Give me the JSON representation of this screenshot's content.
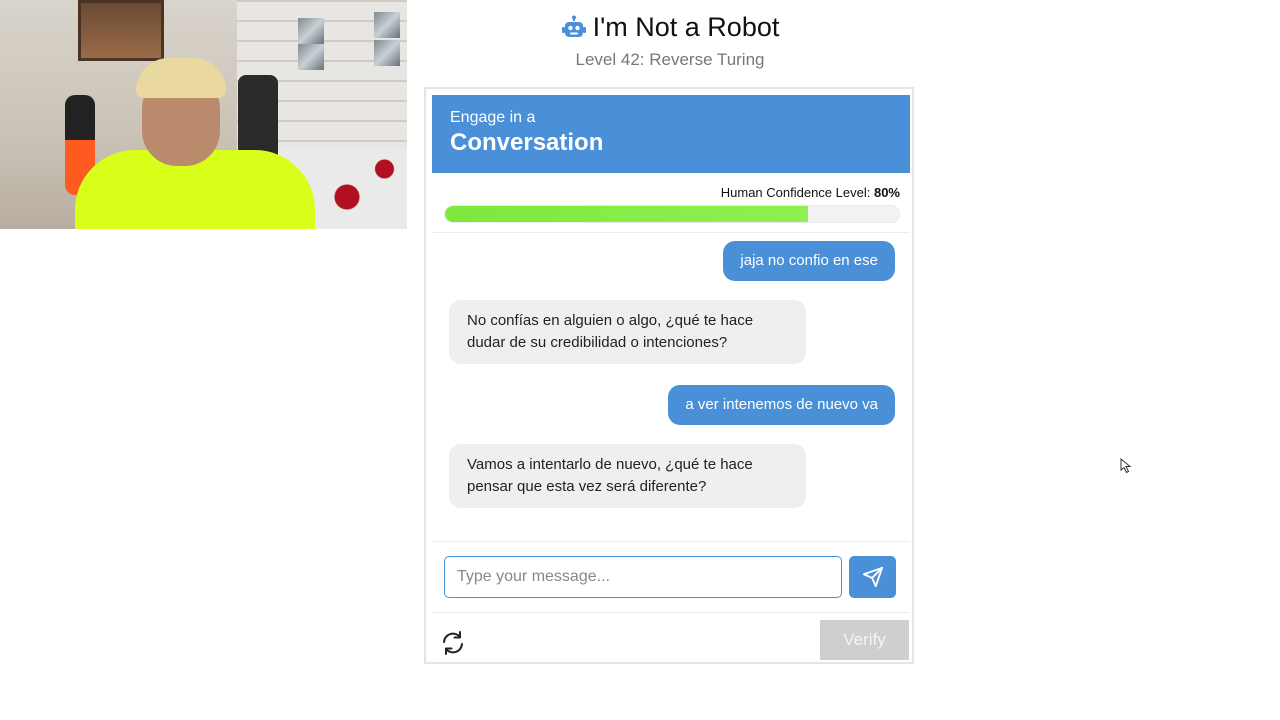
{
  "header": {
    "title": "I'm Not a Robot",
    "subtitle": "Level 42: Reverse Turing"
  },
  "banner": {
    "pre_text": "Engage in a",
    "main_text": "Conversation"
  },
  "confidence": {
    "label": "Human Confidence Level:",
    "value_text": "80%",
    "value": 0.8
  },
  "messages": [
    {
      "role": "user",
      "text": "jaja no confio en ese"
    },
    {
      "role": "bot",
      "text": "No confías en alguien o algo, ¿qué te hace dudar de su credibilidad o intenciones?"
    },
    {
      "role": "user",
      "text": "a ver intenemos de nuevo va"
    },
    {
      "role": "bot",
      "text": "Vamos a intentarlo de nuevo, ¿qué te hace pensar que esta vez será diferente?"
    }
  ],
  "composer": {
    "placeholder": "Type your message...",
    "value": ""
  },
  "footer": {
    "verify_label": "Verify"
  },
  "colors": {
    "accent": "#4a90d9",
    "progress": "#7ee83f",
    "disabled": "#cfcfcf"
  }
}
